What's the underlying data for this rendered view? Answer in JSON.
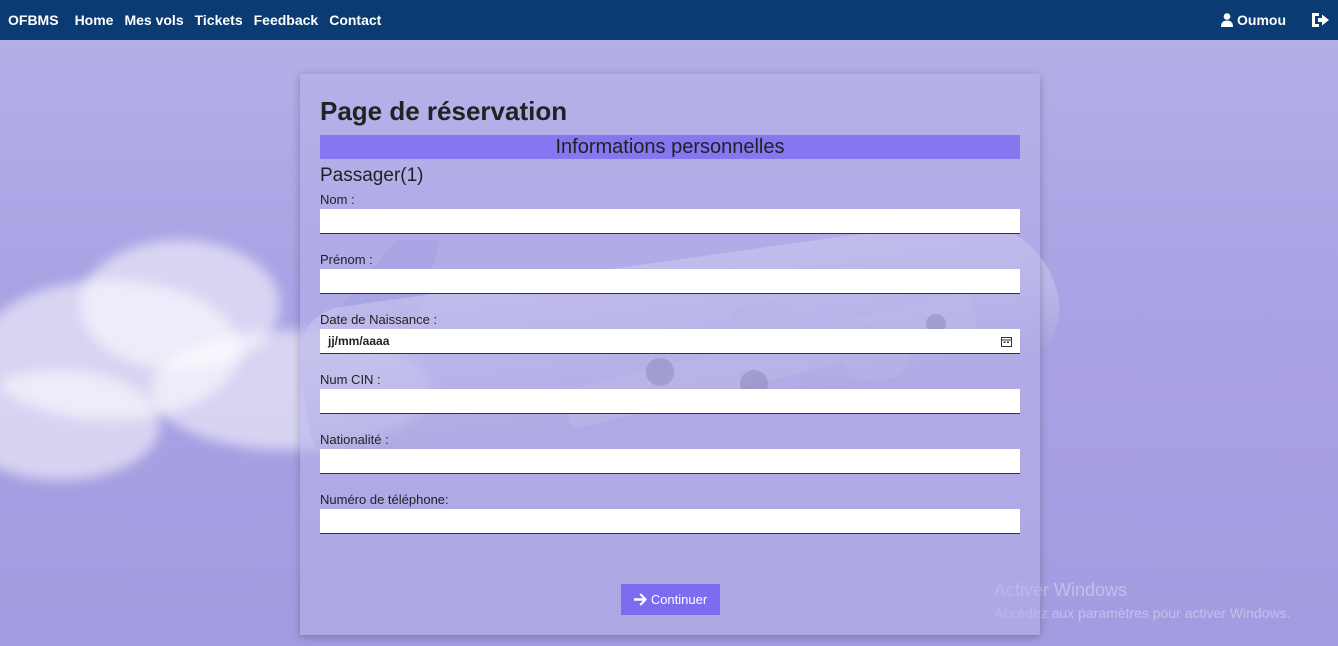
{
  "nav": {
    "brand": "OFBMS",
    "links": [
      "Home",
      "Mes vols",
      "Tickets",
      "Feedback",
      "Contact"
    ],
    "user": "Oumou"
  },
  "form": {
    "title": "Page de réservation",
    "section": "Informations personnelles",
    "passenger": "Passager(1)",
    "fields": [
      {
        "label": "Nom :",
        "value": ""
      },
      {
        "label": "Prénom :",
        "value": ""
      },
      {
        "label": "Date de Naissance :",
        "value": "jj/mm/aaaa"
      },
      {
        "label": "Num CIN :",
        "value": ""
      },
      {
        "label": "Nationalité :",
        "value": ""
      },
      {
        "label": "Numéro de téléphone:",
        "value": ""
      }
    ],
    "submit": "Continuer"
  },
  "watermark": {
    "title": "Activer Windows",
    "subtitle": "Accédez aux paramètres pour activer Windows."
  },
  "colors": {
    "navbar": "#0b3b73",
    "section_bar": "#8676f0",
    "button": "#7b6cf0"
  }
}
